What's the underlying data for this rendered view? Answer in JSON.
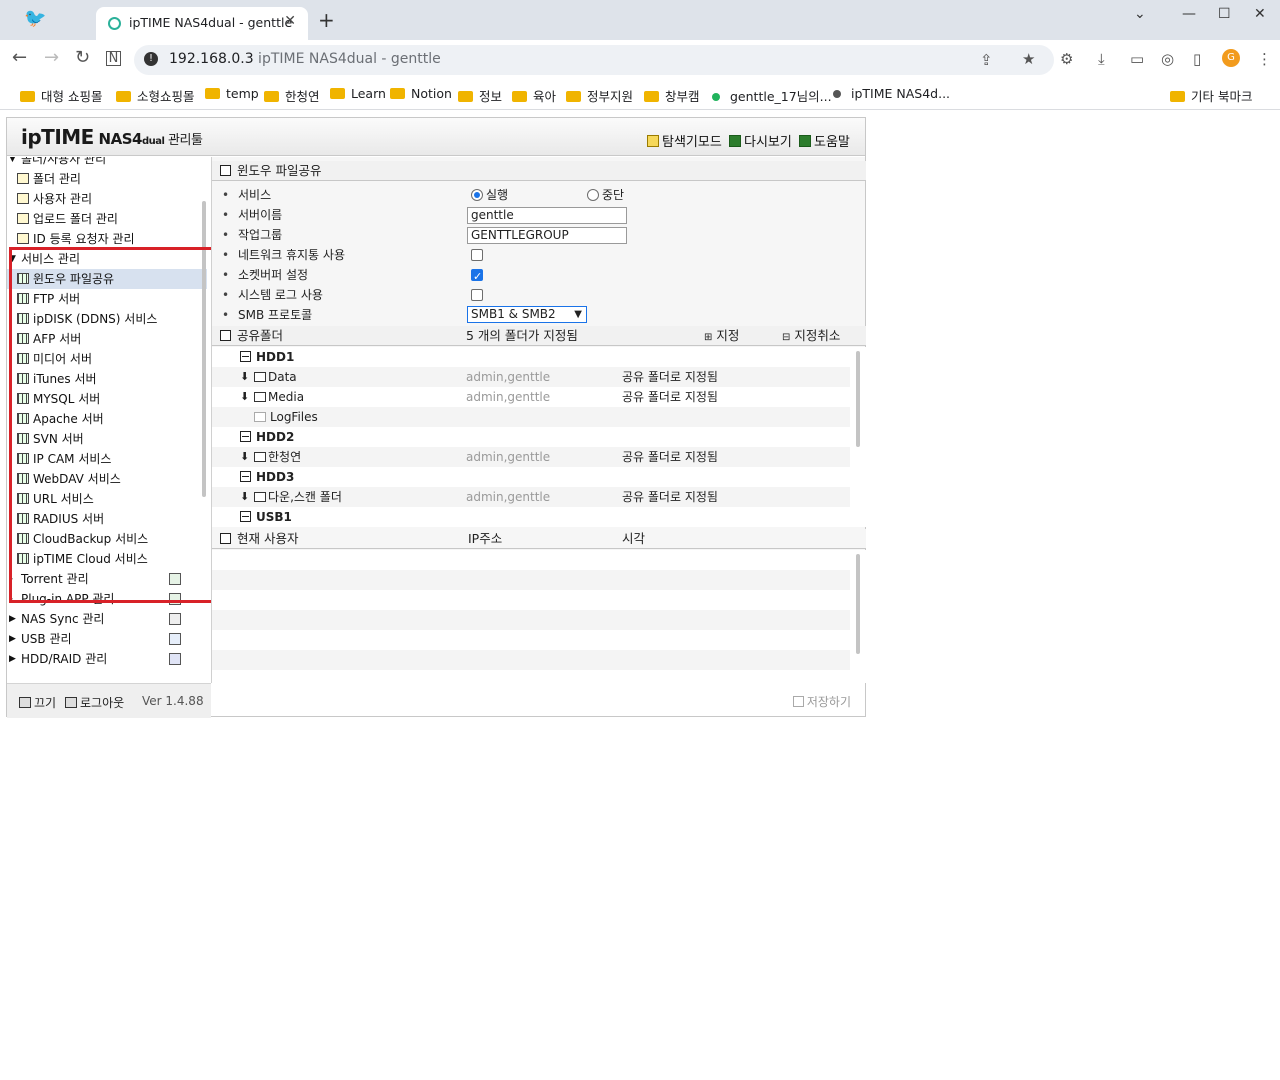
{
  "browser": {
    "tab_title": "ipTIME NAS4dual - genttle",
    "tab_close": "✕",
    "new_tab": "+",
    "url_host": "192.168.0.3",
    "url_title": " ipTIME NAS4dual - genttle",
    "profile_initial": "G"
  },
  "bookmarks": [
    "대형 쇼핑몰",
    "소형쇼핑몰",
    "temp",
    "한청연",
    "Learn",
    "Notion",
    "정보",
    "육아",
    "정부지원",
    "창부캠",
    "genttle_17님의...",
    "ipTIME NAS4d..."
  ],
  "bookmarks_other": "기타 북마크",
  "header": {
    "logo_ip": "ip",
    "logo_time": "TIME",
    "logo_nas": " NAS4",
    "logo_dual": "dual",
    "logo_tool": " 관리툴",
    "explore_mode": "탐색기모드",
    "refresh": "다시보기",
    "help": "도움말"
  },
  "sidebar": {
    "top_cut": "폴더/사용자 관리",
    "folder_items": [
      "폴더 관리",
      "사용자 관리",
      "업로드 폴더 관리",
      "ID 등록 요청자 관리"
    ],
    "service_cat": "서비스 관리",
    "service_items": [
      "윈도우 파일공유",
      "FTP 서버",
      "ipDISK (DDNS) 서비스",
      "AFP 서버",
      "미디어 서버",
      "iTunes 서버",
      "MYSQL 서버",
      "Apache 서버",
      "SVN 서버",
      "IP CAM 서비스",
      "WebDAV 서비스",
      "URL 서비스",
      "RADIUS 서버",
      "CloudBackup 서비스",
      "ipTIME Cloud 서비스"
    ],
    "torrent": "Torrent 관리",
    "plugin": "Plug-in APP 관리",
    "nas_sync": "NAS Sync 관리",
    "usb": "USB 관리",
    "hdd_raid": "HDD/RAID 관리"
  },
  "footer": {
    "power_off": "끄기",
    "logout": "로그아웃",
    "version": "Ver 1.4.88"
  },
  "main": {
    "section_title": "윈도우 파일공유",
    "service_label": "서비스",
    "run_label": "실행",
    "stop_label": "중단",
    "server_name_label": "서버이름",
    "server_name_value": "genttle",
    "workgroup_label": "작업그룹",
    "workgroup_value": "GENTTLEGROUP",
    "recycle_label": "네트워크 휴지통 사용",
    "socket_label": "소켓버퍼 설정",
    "syslog_label": "시스템 로그 사용",
    "smb_label": "SMB 프로토콜",
    "smb_value": "SMB1 & SMB2",
    "share_title": "공유폴더",
    "share_count": "5  개의 폴더가 지정됨",
    "assign": "지정",
    "unassign": "지정취소",
    "hdd1": "HDD1",
    "f_data": "Data",
    "f_media": "Media",
    "f_logfiles": "LogFiles",
    "hdd2": "HDD2",
    "f_hancheong": "한청연",
    "hdd3": "HDD3",
    "f_download": "다운,스캔 폴더",
    "usb1": "USB1",
    "users": "admin,genttle",
    "assigned_state": "공유 폴더로 지정됨",
    "cur_user_title": "현재 사용자",
    "ip_col": "IP주소",
    "time_col": "시각",
    "save": "저장하기"
  },
  "colors": {
    "highlight": "#d82128",
    "active_row": "#d7e1ef",
    "accent": "#1a73e8"
  }
}
